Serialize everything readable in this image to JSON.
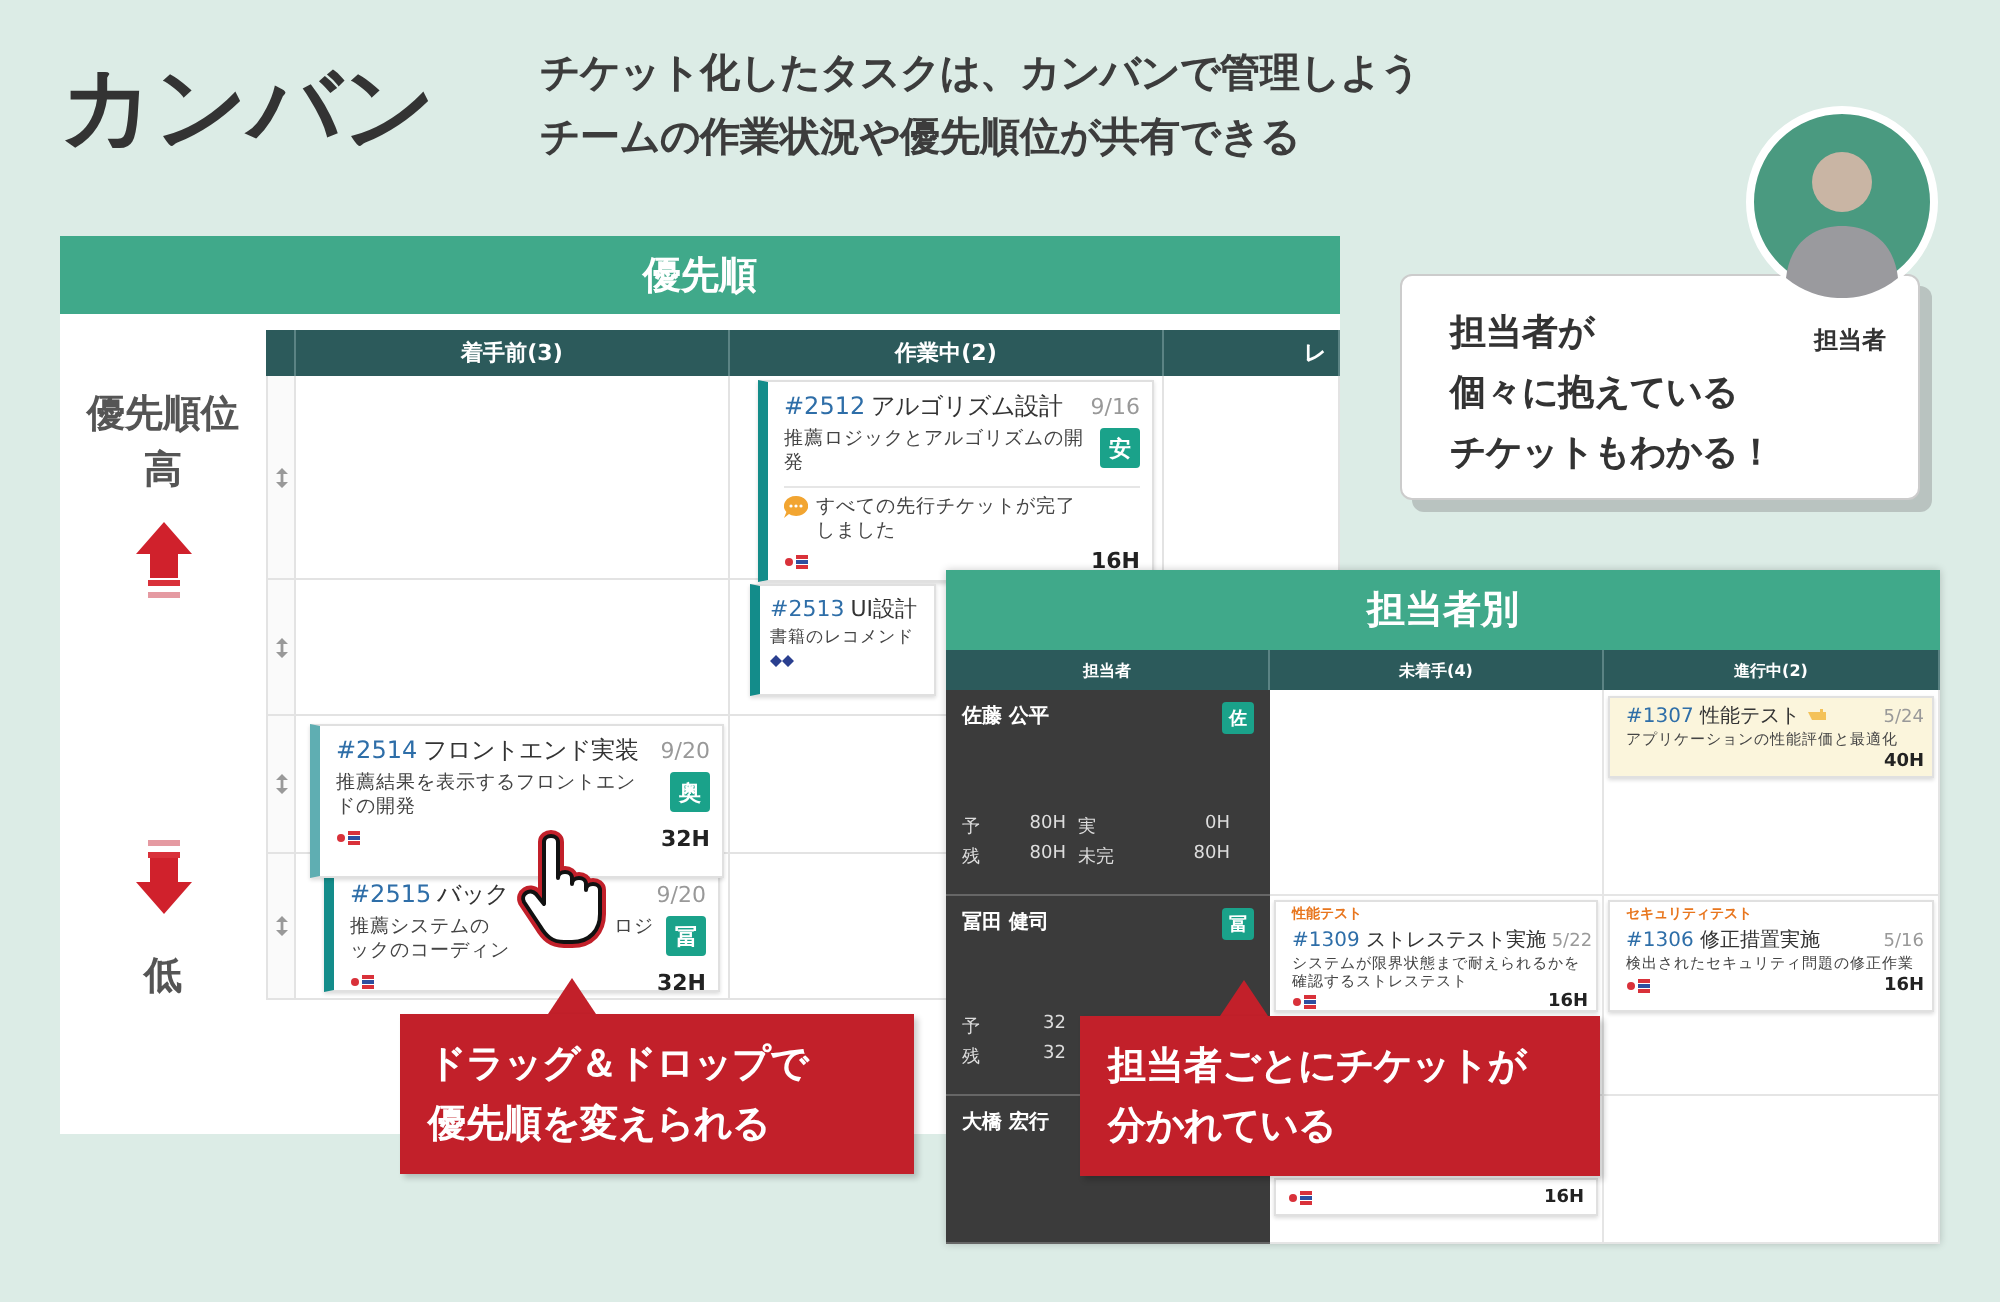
{
  "page": {
    "title": "カンバン",
    "subtitle_lines": [
      "チケット化したタスクは、カンバンで管理しよう",
      "チームの作業状況や優先順位が共有できる"
    ]
  },
  "priority_board": {
    "title": "優先順",
    "axis": {
      "label": "優先順位",
      "high": "高",
      "low": "低"
    },
    "columns": [
      "着手前(3)",
      "作業中(2)",
      "レ"
    ],
    "lanes": [
      {
        "cells": [
          [],
          [
            {
              "kind": "card",
              "number": "#2512",
              "title": "アルゴリズム設計",
              "date": "9/16",
              "desc": "推薦ロジックとアルゴリズムの開発",
              "assignee": "安",
              "note": "すべての先行チケットが完了しました",
              "hours": "16H"
            }
          ],
          []
        ]
      },
      {
        "cells": [
          [],
          [
            {
              "kind": "clipped",
              "number": "#2513",
              "title": "UI設計",
              "desc": "書籍のレコメンド"
            }
          ],
          []
        ]
      },
      {
        "cells": [
          [
            {
              "kind": "ghost"
            }
          ],
          [],
          []
        ]
      },
      {
        "cells": [
          [
            {
              "kind": "partly_hidden",
              "number": "#2515",
              "title": "バック",
              "date": "9/20",
              "desc_parts": [
                "推薦システムの",
                "ロジ",
                "ックのコーディン"
              ],
              "assignee": "冨",
              "hours": "32H"
            }
          ],
          [],
          []
        ]
      }
    ],
    "dragging_card": {
      "number": "#2514",
      "title": "フロントエンド実装",
      "date": "9/20",
      "desc": "推薦結果を表示するフロントエンドの開発",
      "assignee": "奥",
      "hours": "32H"
    }
  },
  "assignee_board": {
    "title": "担当者別",
    "columns": [
      "担当者",
      "未着手(4)",
      "進行中(2)"
    ],
    "rows": [
      {
        "name": "佐藤 公平",
        "badge": "佐",
        "stats": [
          [
            "予",
            "80H",
            "実",
            "0H"
          ],
          [
            "残",
            "80H",
            "未完",
            "80H"
          ]
        ],
        "cells": [
          [],
          [
            {
              "kind": "card",
              "highlighted": true,
              "number": "#1307",
              "title": "性能テスト",
              "date": "5/24",
              "desc": "アプリケーションの性能評価と最適化",
              "hours": "40H"
            }
          ]
        ]
      },
      {
        "name": "冨田 健司",
        "badge": "冨",
        "stats": [
          [
            "予",
            "32"
          ],
          [
            "残",
            "32"
          ]
        ],
        "cells": [
          [
            {
              "kind": "card",
              "highlighted": false,
              "tag": "性能テスト",
              "number": "#1309",
              "title": "ストレステスト実施",
              "date": "5/22",
              "desc": "システムが限界状態まで耐えられるかを確認するストレステスト",
              "hours": "16H"
            }
          ],
          [
            {
              "kind": "card",
              "highlighted": false,
              "tag": "セキュリティテスト",
              "number": "#1306",
              "title": "修正措置実施",
              "date": "5/16",
              "desc": "検出されたセキュリティ問題の修正作業",
              "hours": "16H"
            }
          ]
        ]
      },
      {
        "name": "大橋 宏行",
        "cells": [
          [
            {
              "kind": "covered",
              "hours": "16H"
            }
          ],
          []
        ]
      }
    ]
  },
  "callouts": [
    {
      "lines": [
        "ドラッグ＆ドロップで",
        "優先順を変えられる"
      ]
    },
    {
      "lines": [
        "担当者ごとにチケットが",
        "分かれている"
      ]
    }
  ],
  "person_card": {
    "label": "担当者",
    "message_lines": [
      "担当者が",
      "個々に抱えている",
      "チケットもわかる！"
    ]
  }
}
